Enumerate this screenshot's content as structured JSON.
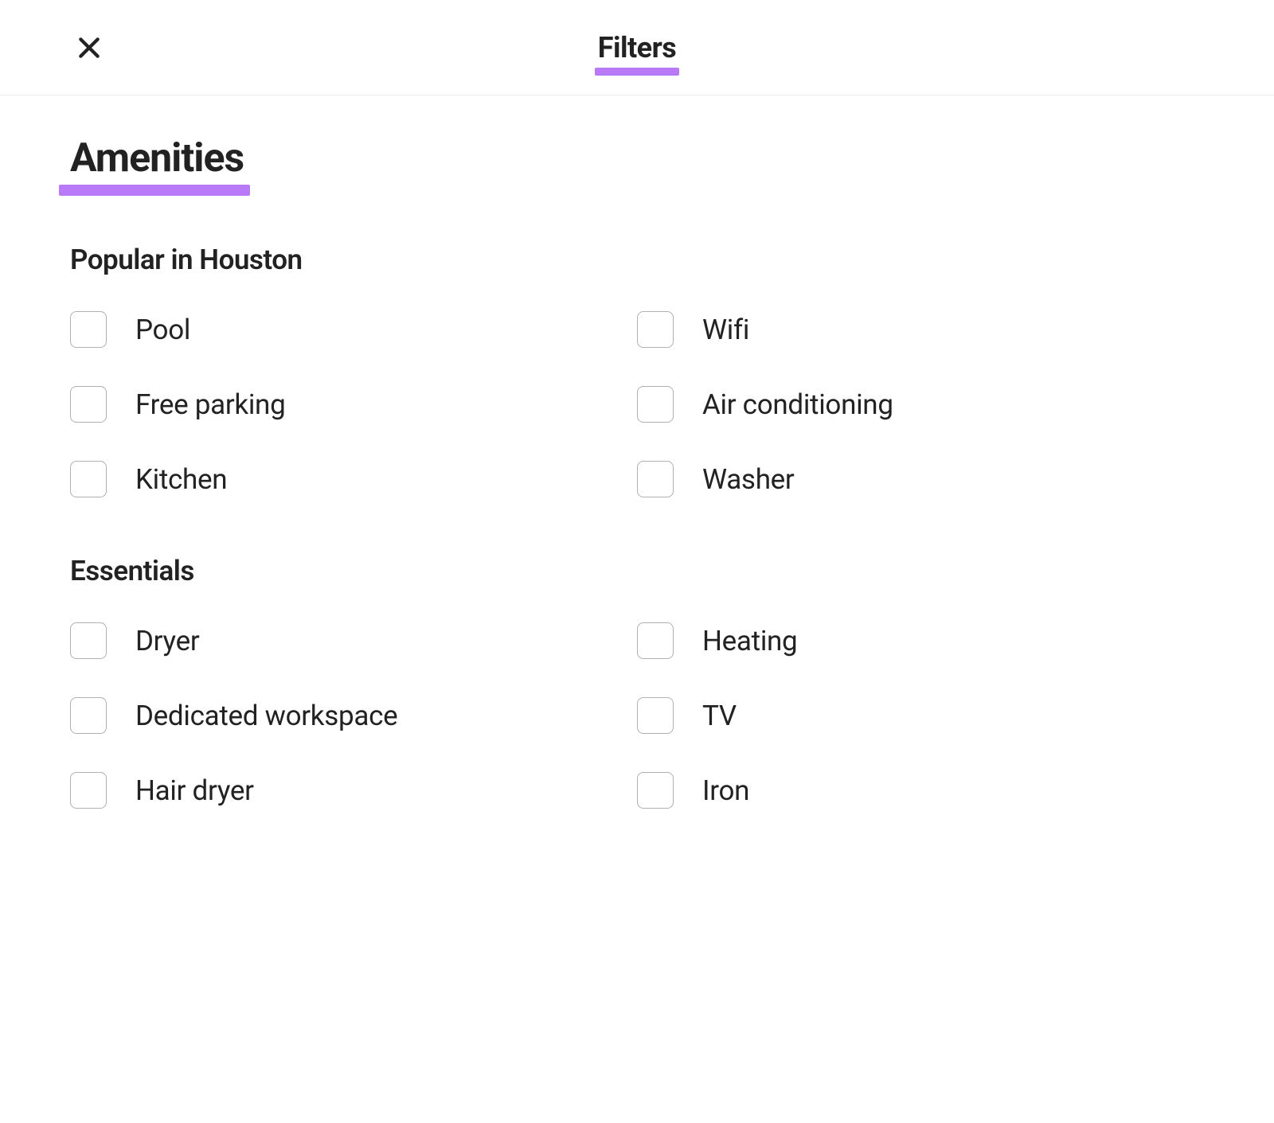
{
  "header": {
    "title": "Filters"
  },
  "section": {
    "title": "Amenities"
  },
  "groups": [
    {
      "title": "Popular in Houston",
      "left": [
        {
          "label": "Pool"
        },
        {
          "label": "Free parking"
        },
        {
          "label": "Kitchen"
        }
      ],
      "right": [
        {
          "label": "Wifi"
        },
        {
          "label": "Air conditioning"
        },
        {
          "label": "Washer"
        }
      ]
    },
    {
      "title": "Essentials",
      "left": [
        {
          "label": "Dryer"
        },
        {
          "label": "Dedicated workspace"
        },
        {
          "label": "Hair dryer"
        }
      ],
      "right": [
        {
          "label": "Heating"
        },
        {
          "label": "TV"
        },
        {
          "label": "Iron"
        }
      ]
    }
  ],
  "highlight_color": "#b87af6"
}
